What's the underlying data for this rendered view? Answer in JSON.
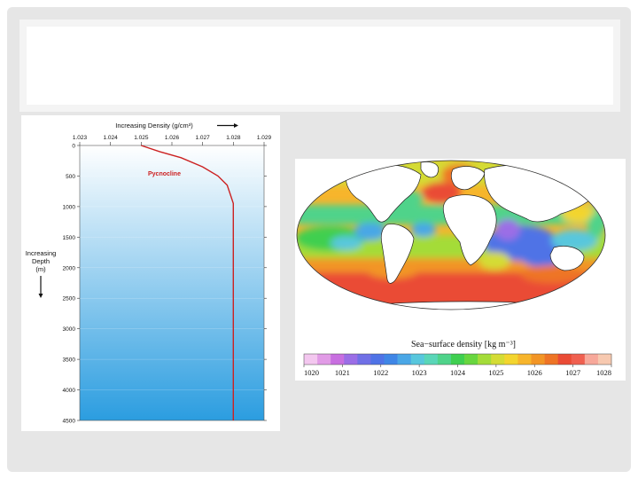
{
  "slide": {
    "title": ""
  },
  "chart_data": [
    {
      "type": "line",
      "title": "Increasing Density (g/cm³)",
      "xlabel": "Increasing Density (g/cm³)",
      "ylabel": "Increasing Depth (m)",
      "ylabel_lines": [
        "Increasing",
        "Depth",
        "(m)"
      ],
      "x_ticks": [
        "1.023",
        "1.024",
        "1.025",
        "1.026",
        "1.027",
        "1.028",
        "1.029"
      ],
      "y_ticks": [
        "0",
        "500",
        "1000",
        "1500",
        "2000",
        "2500",
        "3000",
        "3500",
        "4000",
        "4500"
      ],
      "xlim": [
        1.023,
        1.029
      ],
      "ylim": [
        0,
        4500
      ],
      "y_inverted": true,
      "annotation": "Pycnocline",
      "series": [
        {
          "x": [
            1.025,
            1.0256,
            1.0263,
            1.027,
            1.0275,
            1.0278,
            1.0279,
            1.028,
            1.028
          ],
          "y": [
            0,
            100,
            200,
            350,
            500,
            650,
            800,
            950,
            4500
          ]
        }
      ],
      "colors": {
        "line": "#cc2222",
        "annotation": "#cc2222",
        "grad_top": "#ffffff",
        "grad_bottom": "#2b9de0"
      }
    },
    {
      "type": "heatmap",
      "title": "Sea−surface density [kg m⁻³]",
      "colorbar_ticks": [
        "1020",
        "1021",
        "1022",
        "1023",
        "1024",
        "1025",
        "1026",
        "1027",
        "1028"
      ],
      "vlim": [
        1020,
        1028
      ],
      "colorbar_colors": [
        "#f3c7ef",
        "#e19be6",
        "#c86fe0",
        "#9b6ee6",
        "#7070e6",
        "#4f73e6",
        "#3f86e6",
        "#4aa7e6",
        "#58c7dd",
        "#5ad6b8",
        "#4fd38a",
        "#3fcf50",
        "#68d63f",
        "#a4dc39",
        "#d4dc35",
        "#f3d52e",
        "#f7b52c",
        "#f29525",
        "#ee7425",
        "#ea4b35",
        "#f06050",
        "#f7a89a",
        "#f7c9b0"
      ],
      "map_colors": {
        "land": "#ffffff",
        "outline": "#222222"
      }
    }
  ]
}
